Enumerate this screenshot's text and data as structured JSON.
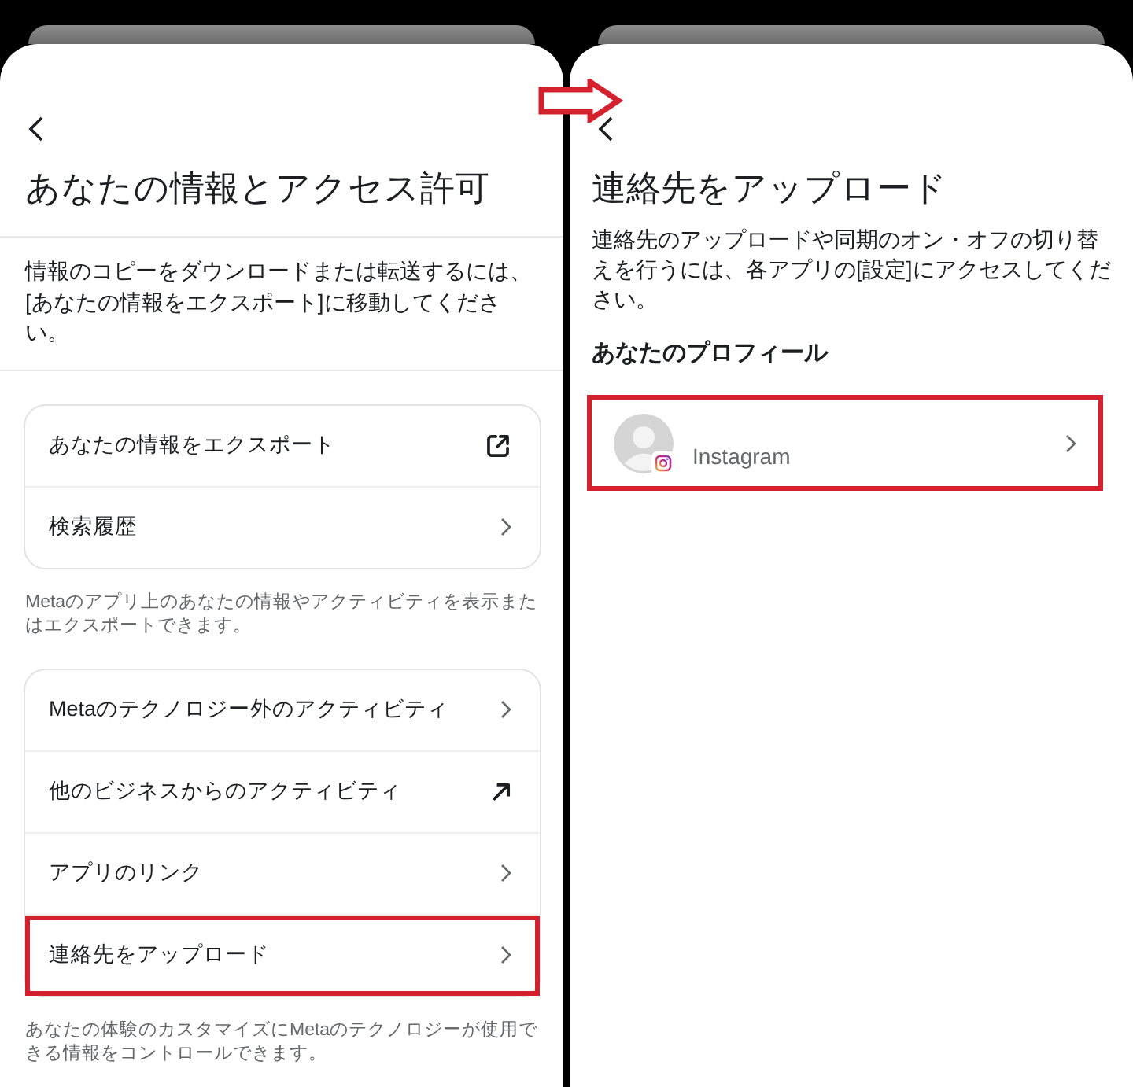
{
  "left_screen": {
    "title": "あなたの情報とアクセス許可",
    "intro": "情報のコピーをダウンロードまたは転送するには、[あなたの情報をエクスポート]に移動してください。",
    "sections": [
      {
        "rows": [
          {
            "label": "あなたの情報をエクスポート",
            "kind": "external",
            "highlighted": false
          },
          {
            "label": "検索履歴",
            "kind": "chevron",
            "highlighted": false
          }
        ],
        "caption": "Metaのアプリ上のあなたの情報やアクティビティを表示またはエクスポートできます。"
      },
      {
        "rows": [
          {
            "label": "Metaのテクノロジー外のアクティビティ",
            "kind": "chevron",
            "highlighted": false
          },
          {
            "label": "他のビジネスからのアクティビティ",
            "kind": "arrow",
            "highlighted": false
          },
          {
            "label": "アプリのリンク",
            "kind": "chevron",
            "highlighted": false
          },
          {
            "label": "連絡先をアップロード",
            "kind": "chevron",
            "highlighted": true
          }
        ],
        "caption": "あなたの体験のカスタマイズにMetaのテクノロジーが使用できる情報をコントロールできます。"
      }
    ]
  },
  "right_screen": {
    "title": "連絡先をアップロード",
    "intro": "連絡先のアップロードや同期のオン・オフの切り替えを行うには、各アプリの[設定]にアクセスしてください。",
    "section_title": "あなたのプロフィール",
    "profiles": [
      {
        "name": "Instagram",
        "highlighted": true
      }
    ]
  }
}
